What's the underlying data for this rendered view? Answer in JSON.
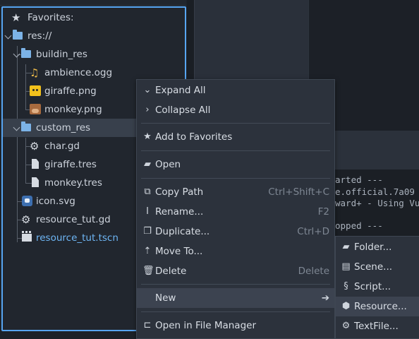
{
  "tree": {
    "favorites": "Favorites:",
    "root": "res://",
    "buildin": "buildin_res",
    "ambience": "ambience.ogg",
    "giraffe_png": "giraffe.png",
    "monkey_png": "monkey.png",
    "custom": "custom_res",
    "char_gd": "char.gd",
    "giraffe_tres": "giraffe.tres",
    "monkey_tres": "monkey.tres",
    "icon_svg": "icon.svg",
    "resource_tut_gd": "resource_tut.gd",
    "resource_tut_tscn": "resource_tut.tscn"
  },
  "console": {
    "line1": "arted ---",
    "line2": "e.official.7a09",
    "line3": "ward+ - Using Vu",
    "line4": "opped ---"
  },
  "menu": {
    "expand_all": "Expand All",
    "collapse_all": "Collapse All",
    "add_favorites": "Add to Favorites",
    "open": "Open",
    "copy_path": "Copy Path",
    "copy_path_sc": "Ctrl+Shift+C",
    "rename": "Rename...",
    "rename_sc": "F2",
    "duplicate": "Duplicate...",
    "duplicate_sc": "Ctrl+D",
    "move_to": "Move To...",
    "delete": "Delete",
    "delete_sc": "Delete",
    "new": "New",
    "open_file_manager": "Open in File Manager"
  },
  "submenu": {
    "folder": "Folder...",
    "scene": "Scene...",
    "script": "Script...",
    "resource": "Resource...",
    "textfile": "TextFile..."
  },
  "colors": {
    "accent": "#57a5f2",
    "selected_row": "#38404c",
    "highlight_text": "#6eb6f5"
  }
}
